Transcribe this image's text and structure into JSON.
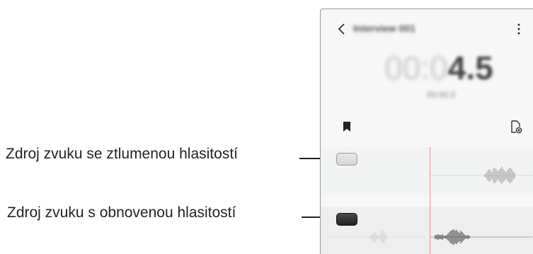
{
  "callouts": {
    "muted_source": "Zdroj zvuku se ztlumenou hlasitostí",
    "restored_source": "Zdroj zvuku s obnovenou hlasitostí"
  },
  "app": {
    "title": "Interview 001",
    "timer_dim": "00:0",
    "timer_bright": "4.5",
    "subtime": "00:00.0",
    "icons": [
      "back-icon",
      "more-icon",
      "bookmark-icon",
      "add-file-icon"
    ]
  },
  "tracks": [
    {
      "state": "muted",
      "toggle": "muted-volume-toggle"
    },
    {
      "state": "restored",
      "toggle": "restored-volume-toggle"
    }
  ],
  "colors": {
    "playhead": "#f08a8a",
    "muted_toggle": "#dcdcdc",
    "active_toggle": "#2b2b2b"
  }
}
